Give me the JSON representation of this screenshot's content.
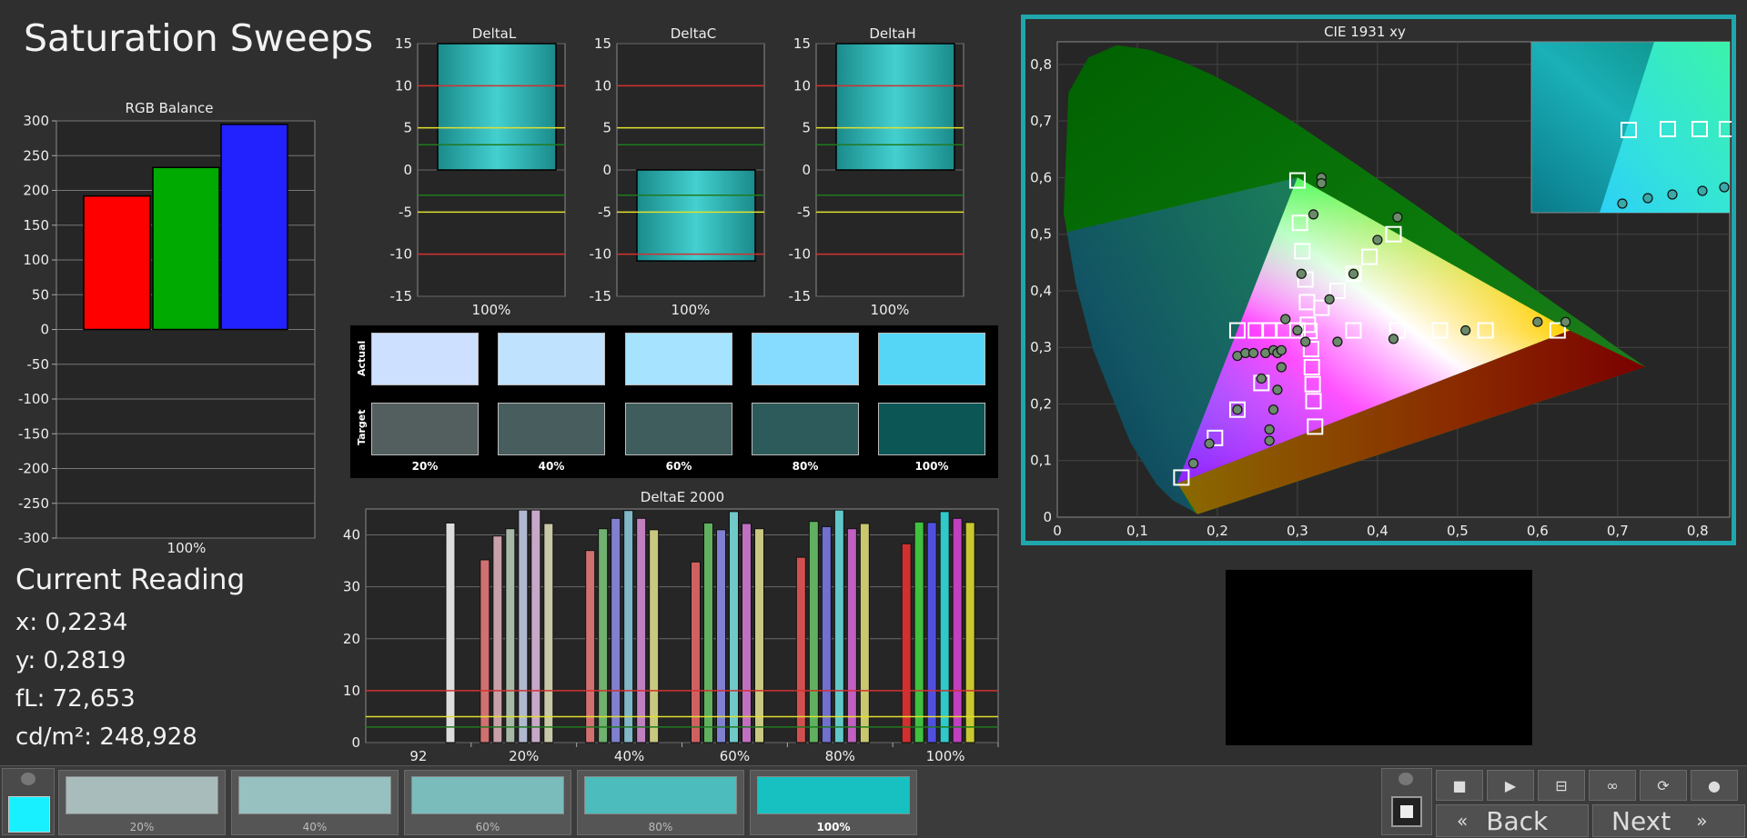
{
  "page": {
    "title": "Saturation Sweeps"
  },
  "rgb_balance": {
    "title": "RGB Balance",
    "xlabel": "100%",
    "ticks": [
      "300",
      "250",
      "200",
      "150",
      "100",
      "50",
      "0",
      "-50",
      "-100",
      "-150",
      "-200",
      "-250",
      "-300"
    ]
  },
  "delta_charts": [
    {
      "title": "DeltaL",
      "xlabel": "100%"
    },
    {
      "title": "DeltaC",
      "xlabel": "100%"
    },
    {
      "title": "DeltaH",
      "xlabel": "100%"
    }
  ],
  "delta_ticks": [
    "15",
    "10",
    "5",
    "0",
    "-5",
    "-10",
    "-15"
  ],
  "swatches": {
    "actual_label": "Actual",
    "target_label": "Target",
    "labels": [
      "20%",
      "40%",
      "60%",
      "80%",
      "100%"
    ],
    "actual_colors": [
      "#cde0ff",
      "#bfe2ff",
      "#a6e3ff",
      "#86dcff",
      "#55d6f6"
    ],
    "target_colors": [
      "#535e5e",
      "#485d5e",
      "#3e5d5c",
      "#2d5b5b",
      "#0d5656"
    ]
  },
  "deltae": {
    "title": "DeltaE 2000",
    "ticks": [
      "40",
      "30",
      "20",
      "10",
      "0"
    ],
    "xlabels": [
      "92",
      "20%",
      "40%",
      "60%",
      "80%",
      "100%"
    ]
  },
  "cie": {
    "title": "CIE 1931 xy",
    "xticks": [
      "0",
      "0,1",
      "0,2",
      "0,3",
      "0,4",
      "0,5",
      "0,6",
      "0,7",
      "0,8"
    ],
    "yticks": [
      "0",
      "0,1",
      "0,2",
      "0,3",
      "0,4",
      "0,5",
      "0,6",
      "0,7",
      "0,8"
    ]
  },
  "reading": {
    "title": "Current Reading",
    "x": "x: 0,2234",
    "y": "y: 0,2819",
    "fl": "fL: 72,653",
    "cdm2": "cd/m²: 248,928"
  },
  "tiles": [
    {
      "label": "20%",
      "color": "#a9bcbc"
    },
    {
      "label": "40%",
      "color": "#97c0c0"
    },
    {
      "label": "60%",
      "color": "#7abcbc"
    },
    {
      "label": "80%",
      "color": "#4cbcbc"
    },
    {
      "label": "100%",
      "color": "#17c1c1"
    }
  ],
  "current_color": "#19f0ff",
  "nav": {
    "back": "Back",
    "next": "Next"
  },
  "chart_data": [
    {
      "type": "bar",
      "title": "RGB Balance",
      "categories": [
        "R",
        "G",
        "B"
      ],
      "values": [
        192,
        233,
        295
      ],
      "ylim": [
        -300,
        300
      ],
      "xlabel": "100%",
      "colors": [
        "#ff0000",
        "#00aa00",
        "#2222ff"
      ]
    },
    {
      "type": "bar",
      "title": "DeltaL",
      "categories": [
        "100%"
      ],
      "values": [
        20
      ],
      "ylim": [
        -15,
        15
      ]
    },
    {
      "type": "bar",
      "title": "DeltaC",
      "categories": [
        "100%"
      ],
      "values": [
        -10.8
      ],
      "ylim": [
        -15,
        15
      ]
    },
    {
      "type": "bar",
      "title": "DeltaH",
      "categories": [
        "100%"
      ],
      "values": [
        20
      ],
      "ylim": [
        -15,
        15
      ]
    },
    {
      "type": "bar",
      "title": "DeltaE 2000",
      "ylim": [
        0,
        45
      ],
      "categories": [
        "92",
        "20%",
        "40%",
        "60%",
        "80%",
        "100%"
      ],
      "series": [
        {
          "values": [
            42.3,
            35.2,
            37.0,
            34.8,
            35.7,
            38.3
          ],
          "colors": [
            "#dddddd",
            "#d07070",
            "#d07070",
            "#d06060",
            "#d05050",
            "#d03030"
          ]
        },
        {
          "values": [
            null,
            39.8,
            41.2,
            42.3,
            42.6,
            42.5
          ],
          "colors": [
            "#dddddd",
            "#c8a0a8",
            "#70b070",
            "#60b060",
            "#60b060",
            "#40c040"
          ]
        },
        {
          "values": [
            null,
            41.2,
            43.2,
            41.0,
            41.6,
            42.4
          ],
          "colors": [
            "#dddddd",
            "#a8b8a8",
            "#8080d0",
            "#8080d0",
            "#7070d0",
            "#5050e0"
          ]
        },
        {
          "values": [
            null,
            44.8,
            44.7,
            44.5,
            44.8,
            44.5
          ],
          "colors": [
            "#dddddd",
            "#b0b8d0",
            "#80b8c8",
            "#70c8c8",
            "#60c8c8",
            "#30c8c8"
          ]
        },
        {
          "values": [
            null,
            44.8,
            43.2,
            42.2,
            41.2,
            43.2
          ],
          "colors": [
            "#dddddd",
            "#c8a8c8",
            "#c080c0",
            "#c070c0",
            "#c060c0",
            "#c040c0"
          ]
        },
        {
          "values": [
            null,
            42.2,
            41.0,
            41.2,
            42.2,
            42.4
          ],
          "colors": [
            "#dddddd",
            "#c8c8a8",
            "#c8c880",
            "#c8c880",
            "#c8c870",
            "#c8c830"
          ]
        }
      ],
      "reference_lines": [
        10,
        5,
        3
      ]
    },
    {
      "type": "scatter",
      "title": "CIE 1931 xy",
      "xlim": [
        0,
        0.84
      ],
      "ylim": [
        0,
        0.84
      ],
      "gamut": [
        [
          0.64,
          0.33
        ],
        [
          0.3,
          0.6
        ],
        [
          0.15,
          0.06
        ]
      ],
      "targets": [
        [
          0.155,
          0.07
        ],
        [
          0.197,
          0.14
        ],
        [
          0.225,
          0.19
        ],
        [
          0.255,
          0.237
        ],
        [
          0.3,
          0.595
        ],
        [
          0.303,
          0.52
        ],
        [
          0.306,
          0.47
        ],
        [
          0.31,
          0.42
        ],
        [
          0.312,
          0.38
        ],
        [
          0.313,
          0.34
        ],
        [
          0.322,
          0.16
        ],
        [
          0.32,
          0.205
        ],
        [
          0.319,
          0.235
        ],
        [
          0.318,
          0.265
        ],
        [
          0.317,
          0.297
        ],
        [
          0.315,
          0.329
        ],
        [
          0.33,
          0.37
        ],
        [
          0.35,
          0.4
        ],
        [
          0.37,
          0.43
        ],
        [
          0.39,
          0.46
        ],
        [
          0.42,
          0.5
        ],
        [
          0.225,
          0.33
        ],
        [
          0.248,
          0.33
        ],
        [
          0.265,
          0.33
        ],
        [
          0.282,
          0.33
        ],
        [
          0.3,
          0.33
        ],
        [
          0.37,
          0.33
        ],
        [
          0.425,
          0.33
        ],
        [
          0.478,
          0.33
        ],
        [
          0.535,
          0.33
        ],
        [
          0.625,
          0.33
        ]
      ],
      "measured": [
        [
          0.17,
          0.095
        ],
        [
          0.19,
          0.13
        ],
        [
          0.225,
          0.285
        ],
        [
          0.235,
          0.29
        ],
        [
          0.245,
          0.29
        ],
        [
          0.255,
          0.245
        ],
        [
          0.26,
          0.29
        ],
        [
          0.27,
          0.295
        ],
        [
          0.275,
          0.29
        ],
        [
          0.28,
          0.295
        ],
        [
          0.285,
          0.35
        ],
        [
          0.3,
          0.33
        ],
        [
          0.305,
          0.43
        ],
        [
          0.31,
          0.31
        ],
        [
          0.32,
          0.535
        ],
        [
          0.33,
          0.6
        ],
        [
          0.33,
          0.59
        ],
        [
          0.34,
          0.385
        ],
        [
          0.35,
          0.31
        ],
        [
          0.37,
          0.43
        ],
        [
          0.4,
          0.49
        ],
        [
          0.42,
          0.315
        ],
        [
          0.425,
          0.53
        ],
        [
          0.51,
          0.33
        ],
        [
          0.6,
          0.345
        ],
        [
          0.635,
          0.345
        ],
        [
          0.225,
          0.19
        ],
        [
          0.265,
          0.155
        ],
        [
          0.265,
          0.135
        ],
        [
          0.27,
          0.19
        ],
        [
          0.275,
          0.225
        ],
        [
          0.28,
          0.265
        ]
      ]
    }
  ]
}
